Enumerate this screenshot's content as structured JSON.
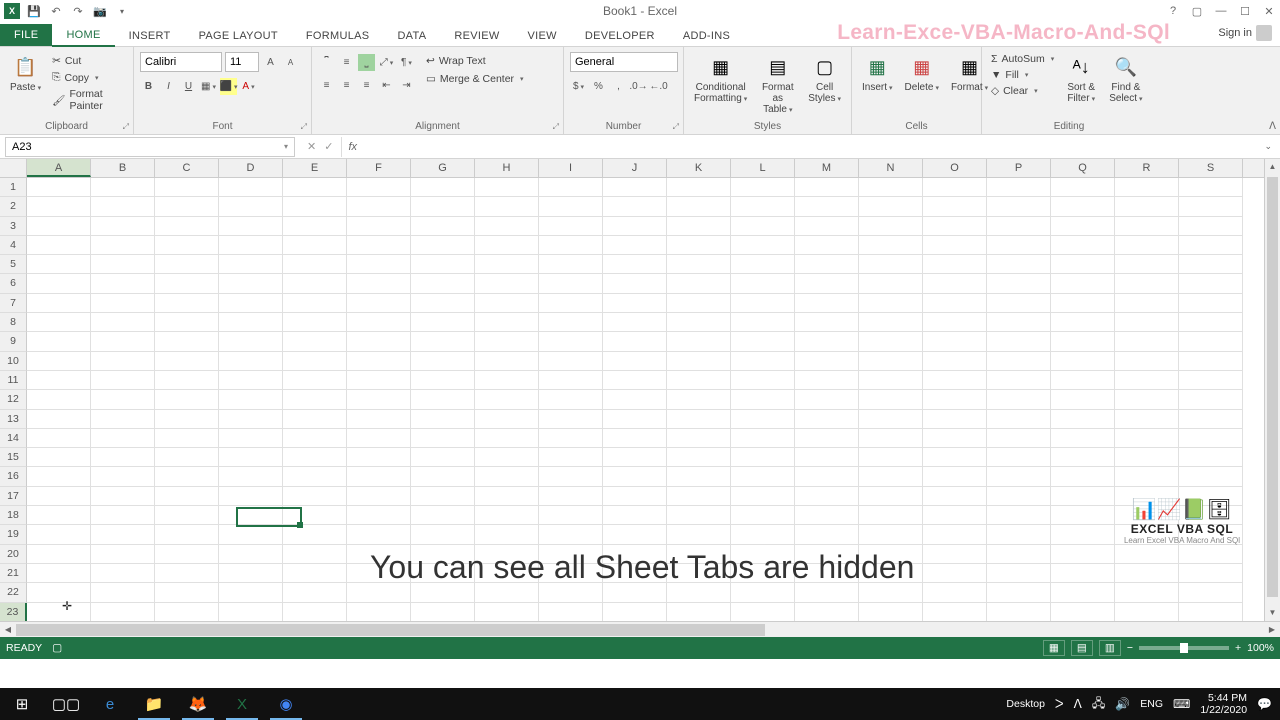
{
  "title": "Book1 - Excel",
  "watermark": "Learn-Exce-VBA-Macro-And-SQl",
  "signin": "Sign in",
  "tabs": {
    "file": "FILE",
    "home": "HOME",
    "insert": "INSERT",
    "pagelayout": "PAGE LAYOUT",
    "formulas": "FORMULAS",
    "data": "DATA",
    "review": "REVIEW",
    "view": "VIEW",
    "developer": "DEVELOPER",
    "addins": "ADD-INS"
  },
  "clipboard": {
    "label": "Clipboard",
    "paste": "Paste",
    "cut": "Cut",
    "copy": "Copy",
    "formatpainter": "Format Painter"
  },
  "font": {
    "label": "Font",
    "name": "Calibri",
    "size": "11"
  },
  "alignment": {
    "label": "Alignment",
    "wrap": "Wrap Text",
    "merge": "Merge & Center"
  },
  "number": {
    "label": "Number",
    "format": "General"
  },
  "styles": {
    "label": "Styles",
    "cond": "Conditional\nFormatting",
    "table": "Format as\nTable",
    "cell": "Cell\nStyles"
  },
  "cells": {
    "label": "Cells",
    "insert": "Insert",
    "delete": "Delete",
    "format": "Format"
  },
  "editing": {
    "label": "Editing",
    "autosum": "AutoSum",
    "fill": "Fill",
    "clear": "Clear",
    "sort": "Sort &\nFilter",
    "find": "Find &\nSelect"
  },
  "namebox": "A23",
  "columns": [
    "A",
    "B",
    "C",
    "D",
    "E",
    "F",
    "G",
    "H",
    "I",
    "J",
    "K",
    "L",
    "M",
    "N",
    "O",
    "P",
    "Q",
    "R",
    "S"
  ],
  "rows": [
    "1",
    "2",
    "3",
    "4",
    "5",
    "6",
    "7",
    "8",
    "9",
    "10",
    "11",
    "12",
    "13",
    "14",
    "15",
    "16",
    "17",
    "18",
    "19",
    "20",
    "21",
    "22",
    "23"
  ],
  "overlay": "You can see all Sheet Tabs are hidden",
  "logo": {
    "title": "EXCEL VBA SQL",
    "sub": "Learn Excel VBA Macro And SQl"
  },
  "status": {
    "ready": "READY"
  },
  "zoom": "100%",
  "tray": {
    "desktop": "Desktop",
    "lang": "ENG",
    "time": "5:44 PM",
    "date": "1/22/2020"
  }
}
